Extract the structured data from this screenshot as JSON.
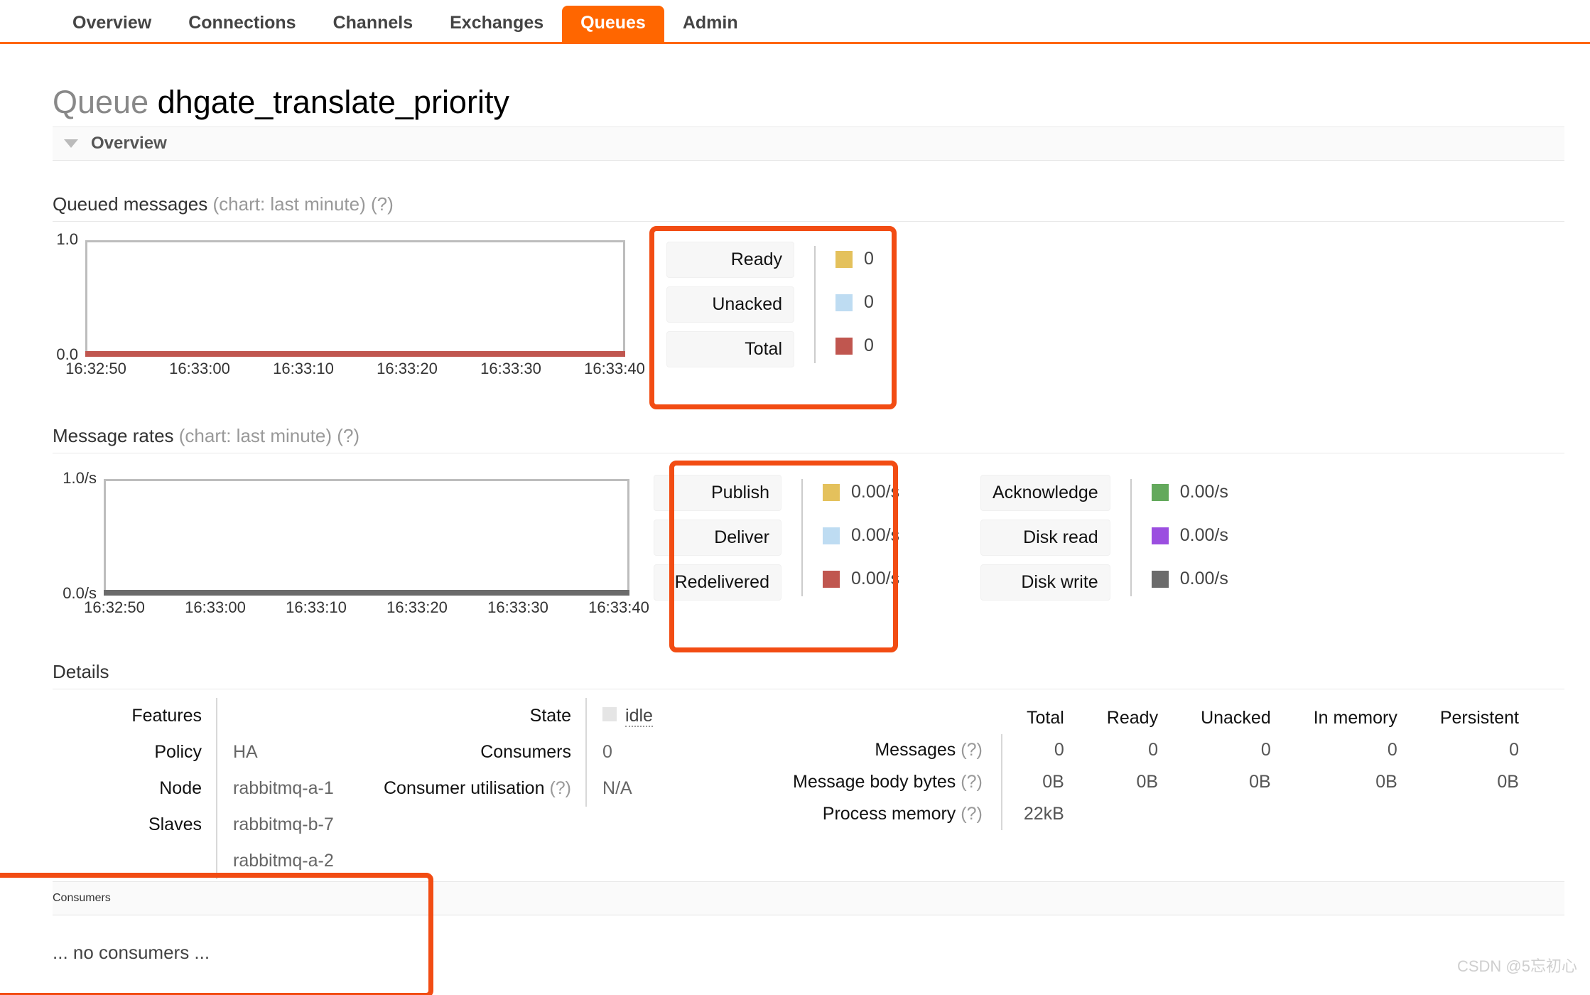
{
  "nav": {
    "items": [
      {
        "label": "Overview",
        "active": false
      },
      {
        "label": "Connections",
        "active": false
      },
      {
        "label": "Channels",
        "active": false
      },
      {
        "label": "Exchanges",
        "active": false
      },
      {
        "label": "Queues",
        "active": true
      },
      {
        "label": "Admin",
        "active": false
      }
    ]
  },
  "page": {
    "title_prefix": "Queue",
    "title_name": "dhgate_translate_priority"
  },
  "sections": {
    "overview_label": "Overview",
    "consumers_label": "Consumers",
    "no_consumers_text": "... no consumers ...",
    "details_label": "Details"
  },
  "queued_messages": {
    "heading": "Queued messages",
    "heading_note": "(chart: last minute)",
    "help": "(?)",
    "legend": [
      {
        "label": "Ready",
        "value": "0",
        "color": "#e4c15c"
      },
      {
        "label": "Unacked",
        "value": "0",
        "color": "#bedcf2"
      },
      {
        "label": "Total",
        "value": "0",
        "color": "#c0564f"
      }
    ]
  },
  "message_rates": {
    "heading": "Message rates",
    "heading_note": "(chart: last minute)",
    "help": "(?)",
    "legend_left": [
      {
        "label": "Publish",
        "value": "0.00/s",
        "color": "#e4c15c"
      },
      {
        "label": "Deliver",
        "value": "0.00/s",
        "color": "#bedcf2"
      },
      {
        "label": "Redelivered",
        "value": "0.00/s",
        "color": "#c0564f"
      }
    ],
    "legend_right": [
      {
        "label": "Acknowledge",
        "value": "0.00/s",
        "color": "#63a95c"
      },
      {
        "label": "Disk read",
        "value": "0.00/s",
        "color": "#9b4ee0"
      },
      {
        "label": "Disk write",
        "value": "0.00/s",
        "color": "#6b6b6b"
      }
    ]
  },
  "chart_data": [
    {
      "type": "line",
      "title": "Queued messages",
      "subtitle": "(chart: last minute)",
      "xlabel": "",
      "ylabel": "",
      "ylim": [
        0.0,
        1.0
      ],
      "ytick_labels": [
        "1.0",
        "0.0"
      ],
      "x": [
        "16:32:50",
        "16:33:00",
        "16:33:10",
        "16:33:20",
        "16:33:30",
        "16:33:40"
      ],
      "grid": false,
      "legend_position": "right",
      "series": [
        {
          "name": "Ready",
          "color": "#e4c15c",
          "values": [
            0,
            0,
            0,
            0,
            0,
            0
          ],
          "current": 0
        },
        {
          "name": "Unacked",
          "color": "#bedcf2",
          "values": [
            0,
            0,
            0,
            0,
            0,
            0
          ],
          "current": 0
        },
        {
          "name": "Total",
          "color": "#c0564f",
          "values": [
            0,
            0,
            0,
            0,
            0,
            0
          ],
          "current": 0
        }
      ]
    },
    {
      "type": "line",
      "title": "Message rates",
      "subtitle": "(chart: last minute)",
      "xlabel": "",
      "ylabel": "",
      "ylim": [
        0.0,
        1.0
      ],
      "ytick_labels": [
        "1.0/s",
        "0.0/s"
      ],
      "x": [
        "16:32:50",
        "16:33:00",
        "16:33:10",
        "16:33:20",
        "16:33:30",
        "16:33:40"
      ],
      "grid": false,
      "legend_position": "right",
      "series": [
        {
          "name": "Publish",
          "color": "#e4c15c",
          "values": [
            0,
            0,
            0,
            0,
            0,
            0
          ],
          "current": "0.00/s"
        },
        {
          "name": "Deliver",
          "color": "#bedcf2",
          "values": [
            0,
            0,
            0,
            0,
            0,
            0
          ],
          "current": "0.00/s"
        },
        {
          "name": "Redelivered",
          "color": "#c0564f",
          "values": [
            0,
            0,
            0,
            0,
            0,
            0
          ],
          "current": "0.00/s"
        },
        {
          "name": "Acknowledge",
          "color": "#63a95c",
          "values": [
            0,
            0,
            0,
            0,
            0,
            0
          ],
          "current": "0.00/s"
        },
        {
          "name": "Disk read",
          "color": "#9b4ee0",
          "values": [
            0,
            0,
            0,
            0,
            0,
            0
          ],
          "current": "0.00/s"
        },
        {
          "name": "Disk write",
          "color": "#6b6b6b",
          "values": [
            0,
            0,
            0,
            0,
            0,
            0
          ],
          "current": "0.00/s"
        }
      ]
    }
  ],
  "details": {
    "col1": {
      "keys": [
        "Features",
        "Policy",
        "Node",
        "Slaves"
      ],
      "values": [
        "",
        "HA",
        "rabbitmq-a-1",
        "rabbitmq-b-7"
      ],
      "slaves_second": "rabbitmq-a-2"
    },
    "col2": {
      "state_key": "State",
      "state_value": "idle",
      "consumers_key": "Consumers",
      "consumers_value": "0",
      "utilisation_key": "Consumer utilisation",
      "utilisation_help": "(?)",
      "utilisation_value": "N/A"
    },
    "stats": {
      "columns": [
        "Total",
        "Ready",
        "Unacked",
        "In memory",
        "Persistent"
      ],
      "rows": [
        {
          "label": "Messages",
          "help": "(?)",
          "values": [
            "0",
            "0",
            "0",
            "0",
            "0"
          ]
        },
        {
          "label": "Message body bytes",
          "help": "(?)",
          "values": [
            "0B",
            "0B",
            "0B",
            "0B",
            "0B"
          ]
        },
        {
          "label": "Process memory",
          "help": "(?)",
          "values": [
            "22kB",
            "",
            "",
            "",
            ""
          ]
        }
      ]
    }
  },
  "watermark": "CSDN @5忘初心",
  "colors": {
    "accent": "#f60",
    "annotation": "#f24c13",
    "baseline_messages": "#c0564f",
    "baseline_rates": "#6b6b6b"
  }
}
